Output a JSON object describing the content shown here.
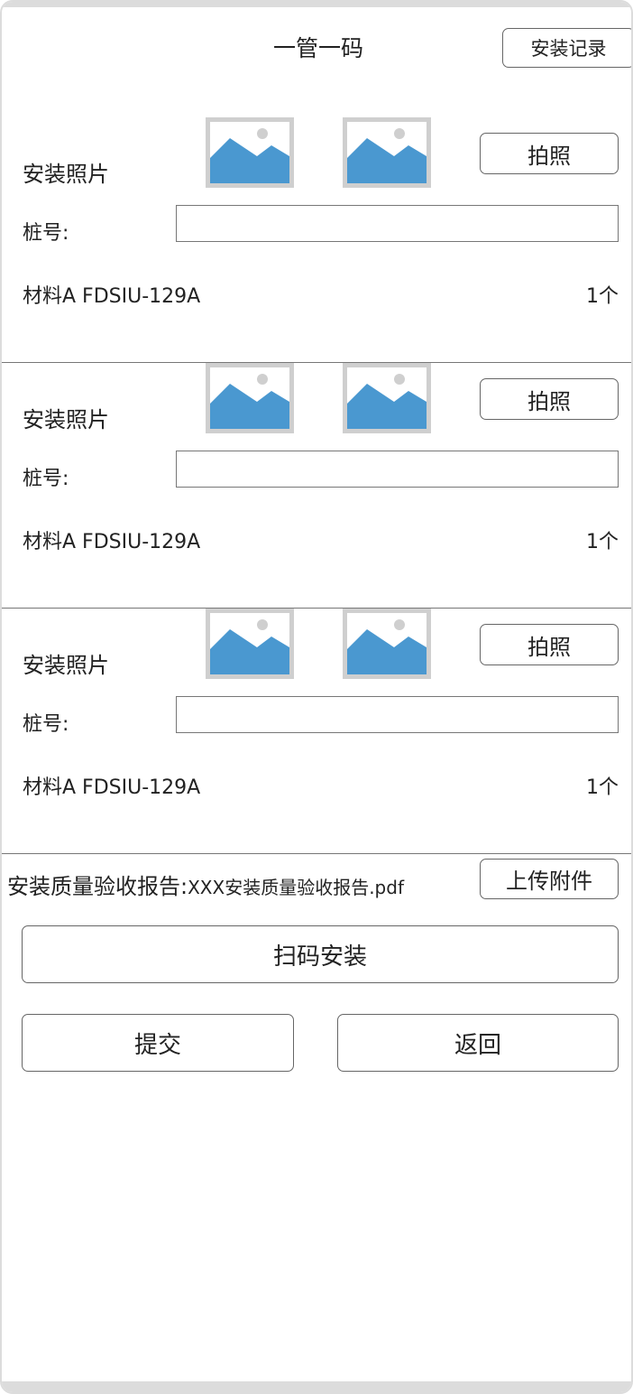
{
  "header": {
    "title": "一管一码",
    "record_button": "安装记录"
  },
  "colors": {
    "image_placeholder_blue": "#4a98d0",
    "image_placeholder_frame": "#cfcfcf",
    "border": "#666666"
  },
  "sections": [
    {
      "photo_label": "安装照片",
      "photo_button": "拍照",
      "pile_label": "桩号:",
      "pile_value": "",
      "material_name": "材料A FDSIU-129A",
      "material_qty": "1个"
    },
    {
      "photo_label": "安装照片",
      "photo_button": "拍照",
      "pile_label": "桩号:",
      "pile_value": "",
      "material_name": "材料A FDSIU-129A",
      "material_qty": "1个"
    },
    {
      "photo_label": "安装照片",
      "photo_button": "拍照",
      "pile_label": "桩号:",
      "pile_value": "",
      "material_name": "材料A FDSIU-129A",
      "material_qty": "1个"
    }
  ],
  "report": {
    "label": "安装质量验收报告:",
    "file_name": "XXX安装质量验收报告.pdf",
    "upload_button": "上传附件"
  },
  "actions": {
    "scan_install": "扫码安装",
    "submit": "提交",
    "back": "返回"
  }
}
